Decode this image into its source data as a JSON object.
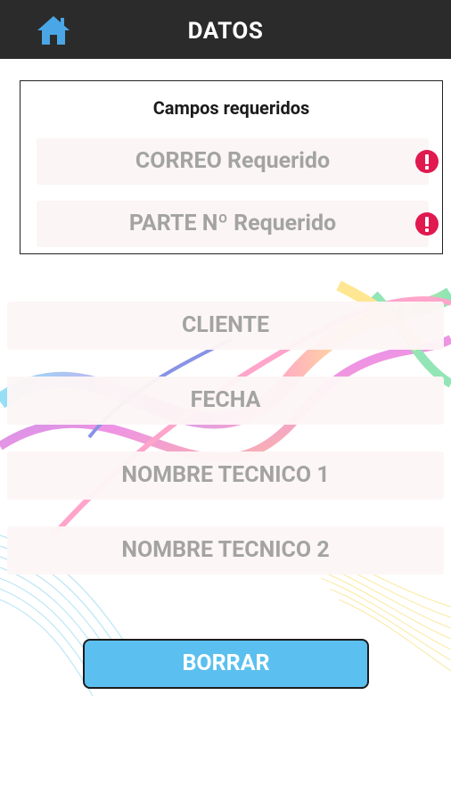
{
  "header": {
    "title": "DATOS",
    "home_icon": "home-icon"
  },
  "required": {
    "title": "Campos requeridos",
    "items": [
      {
        "label": "CORREO Requerido",
        "icon": "error-icon"
      },
      {
        "label": "PARTE Nº Requerido",
        "icon": "error-icon"
      }
    ]
  },
  "form": {
    "fields": [
      {
        "placeholder": "CLIENTE"
      },
      {
        "placeholder": "FECHA"
      },
      {
        "placeholder": "NOMBRE TECNICO 1"
      },
      {
        "placeholder": "NOMBRE TECNICO 2"
      }
    ],
    "button": "BORRAR"
  },
  "colors": {
    "topbar": "#2b2b2b",
    "home_icon": "#4aa6e6",
    "error": "#e0194f",
    "button": "#5bc0ef",
    "placeholder_text": "#a3a3a3"
  }
}
